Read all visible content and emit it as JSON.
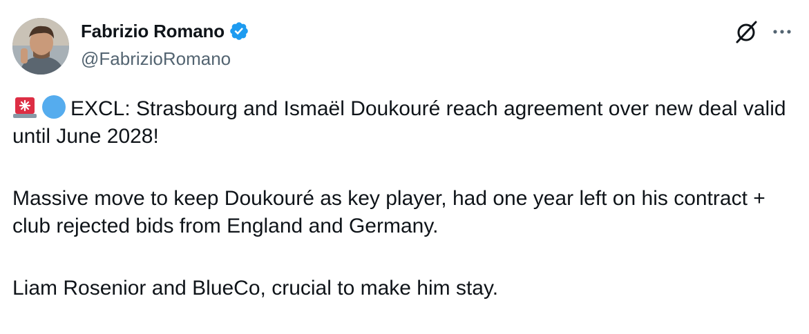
{
  "author": {
    "display_name": "Fabrizio Romano",
    "handle": "@FabrizioRomano",
    "verified": true,
    "avatar_icon": "avatar-photo",
    "verified_color": "#1d9bf0"
  },
  "actions": {
    "grok_icon": "grok-icon",
    "more_icon": "more-icon"
  },
  "tweet": {
    "emojis": [
      "rotating-light-emoji",
      "blue-circle-emoji"
    ],
    "line1": "EXCL: Strasbourg and Ismaël Doukouré reach agreement over new deal valid until June 2028!",
    "line2": "Massive move to keep Doukouré as key player, had one year left on his contract + club rejected bids from England and Germany.",
    "line3": "Liam Rosenior and BlueCo, crucial to make him stay."
  },
  "colors": {
    "text_primary": "#0f1419",
    "text_secondary": "#536471",
    "blue_circle": "#55acee",
    "siren_red": "#dd2e44"
  }
}
